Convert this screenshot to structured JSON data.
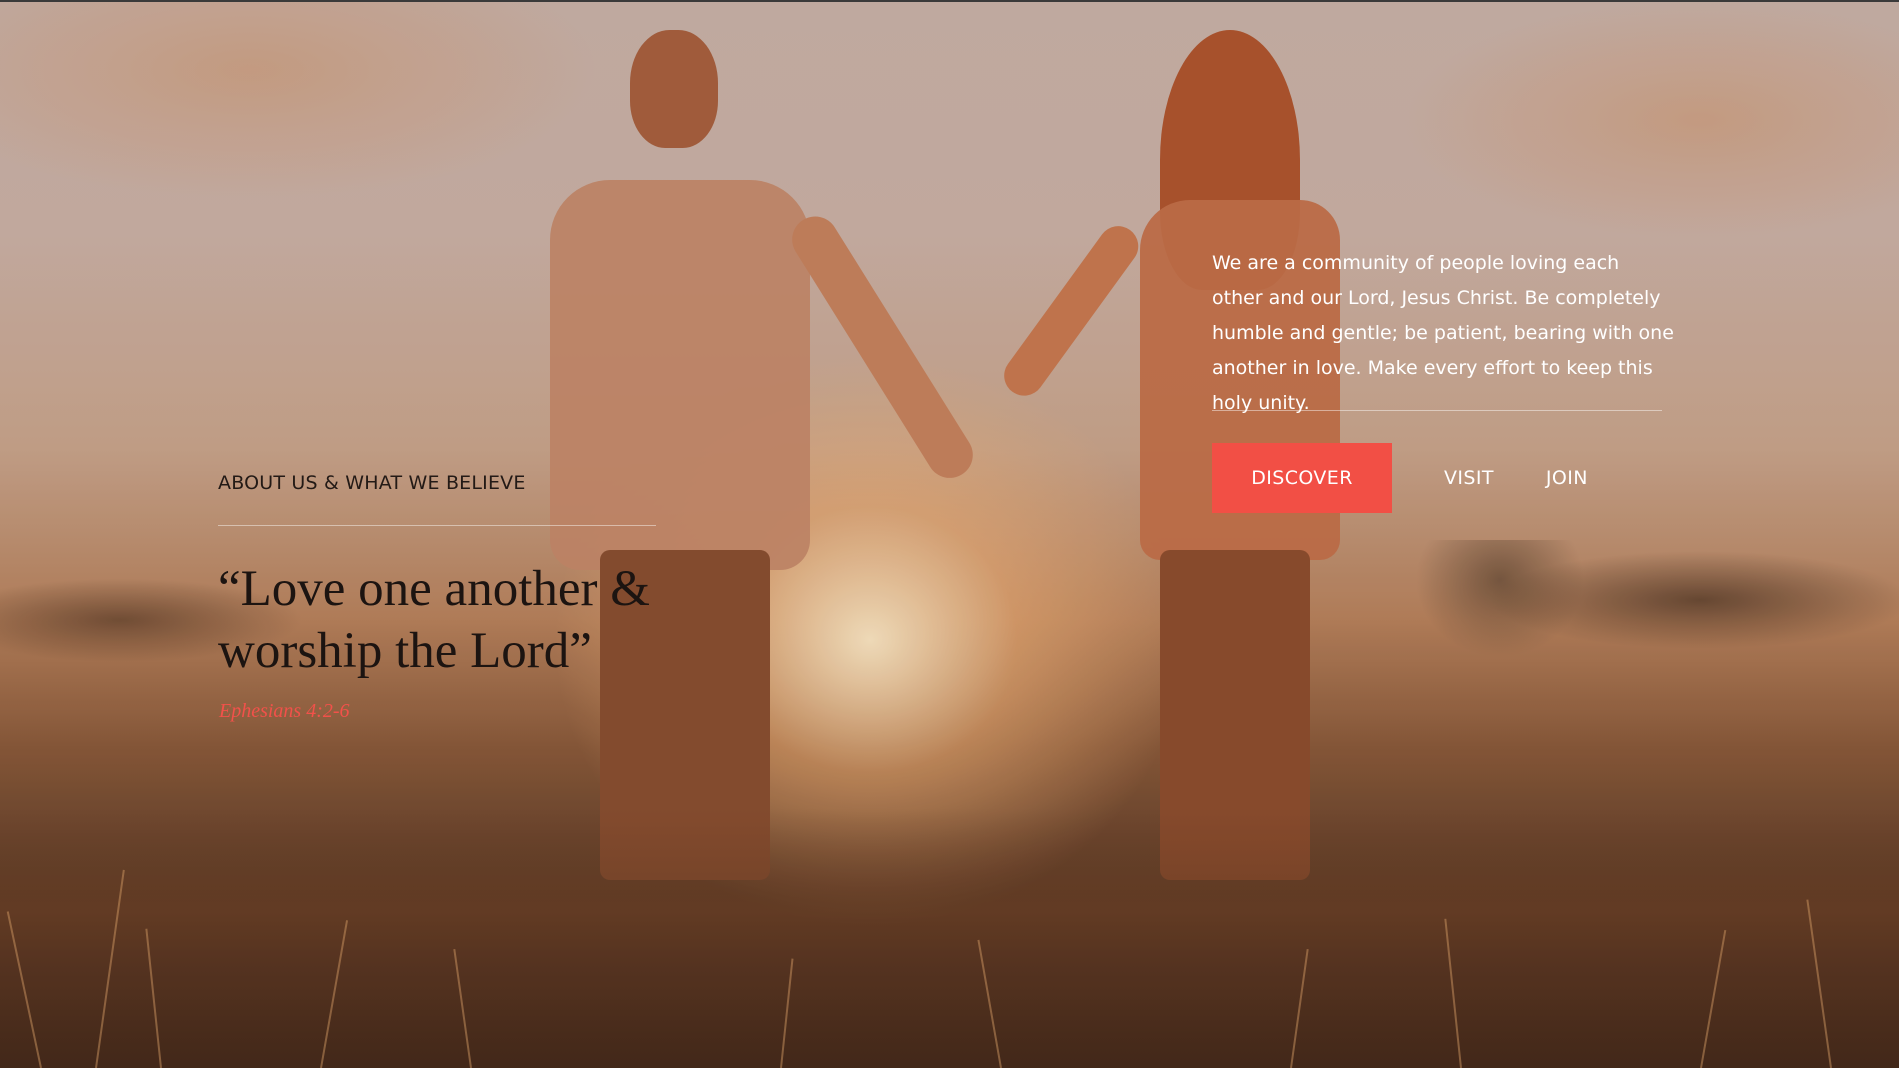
{
  "about": {
    "kicker": "ABOUT US & WHAT WE BELIEVE",
    "quote": "“Love one another & worship the Lord”",
    "citation": "Ephesians 4:2-6"
  },
  "intro": {
    "text": "We are a community of people loving each other and our Lord, Jesus Christ. Be completely humble and gentle; be patient, bearing with one another in love. Make every effort to keep this holy unity."
  },
  "actions": {
    "discover": "DISCOVER",
    "visit": "VISIT",
    "join": "JOIN"
  },
  "colors": {
    "accent": "#f24f45",
    "citation": "#f2514a",
    "heading": "#1c1411",
    "light_text": "#ffffff"
  }
}
